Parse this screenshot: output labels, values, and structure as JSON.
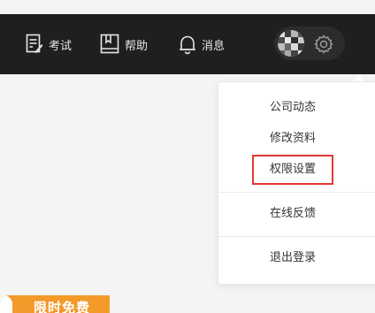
{
  "nav": {
    "items": [
      {
        "label": "考试",
        "icon": "exam-paper-icon"
      },
      {
        "label": "帮助",
        "icon": "book-icon"
      },
      {
        "label": "消息",
        "icon": "bell-icon"
      }
    ]
  },
  "user": {
    "avatar_icon": "avatar",
    "settings_icon": "gear-icon"
  },
  "dropdown": {
    "items": [
      {
        "label": "公司动态"
      },
      {
        "label": "修改资料"
      },
      {
        "label": "权限设置",
        "highlighted": true,
        "highlight_color": "#e53935"
      },
      {
        "label": "在线反馈"
      },
      {
        "label": "退出登录"
      }
    ]
  },
  "promo": {
    "label": "限时免费",
    "color": "#f39a2b"
  },
  "colors": {
    "navbar_bg": "#1f1f1f",
    "page_bg": "#f4f4f4",
    "accent": "#f39a2b"
  }
}
